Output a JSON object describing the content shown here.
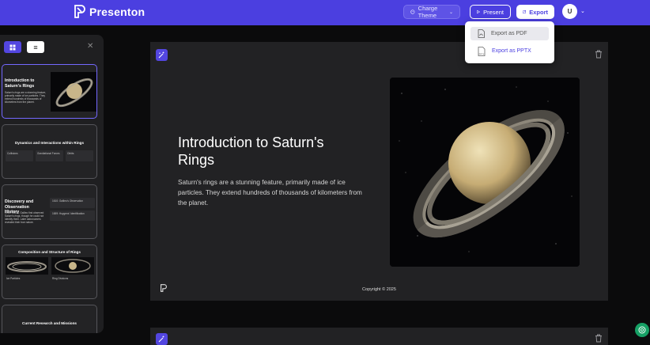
{
  "header": {
    "brand": "Presenton",
    "theme_label": "Charge Theme",
    "present_label": "Present",
    "export_label": "Export",
    "avatar_initial": "U"
  },
  "export_menu": {
    "pdf_label": "Export as PDF",
    "pptx_label": "Export as PPTX",
    "pptx_badge": "PPTX"
  },
  "sidebar": {
    "list_label": "≡",
    "thumbnails": [
      {
        "title": "Introduction to Saturn's Rings",
        "text": "Saturn's rings are a stunning feature, primarily made of ice particles. They extend hundreds of thousands of kilometers from the planet."
      },
      {
        "title": "Dynamics and Interactions within Rings",
        "cols": [
          "Collisions",
          "Gravitational Forces",
          "Orbits"
        ]
      },
      {
        "title": "Discovery and Observation History",
        "text": "In the 1600s, Galileo first observed Saturn's rings, though he could not identify them. Later astronomers revealed their true nature.",
        "items": [
          "1610: Galileo's Observation",
          "1659: Huygens' Identification"
        ]
      },
      {
        "title": "Composition and Structure of Rings",
        "cards": [
          "Ice Particles",
          "Ring Divisions"
        ]
      },
      {
        "title": "Current Research and Missions"
      }
    ]
  },
  "slide": {
    "title": "Introduction to Saturn's Rings",
    "description": "Saturn's rings are a stunning feature, primarily made of ice particles. They extend hundreds of thousands of kilometers from the planet.",
    "copyright": "Copyright © 2025"
  },
  "colors": {
    "brand": "#4b3fe0",
    "accent": "#5346e0",
    "help": "#16a065"
  }
}
